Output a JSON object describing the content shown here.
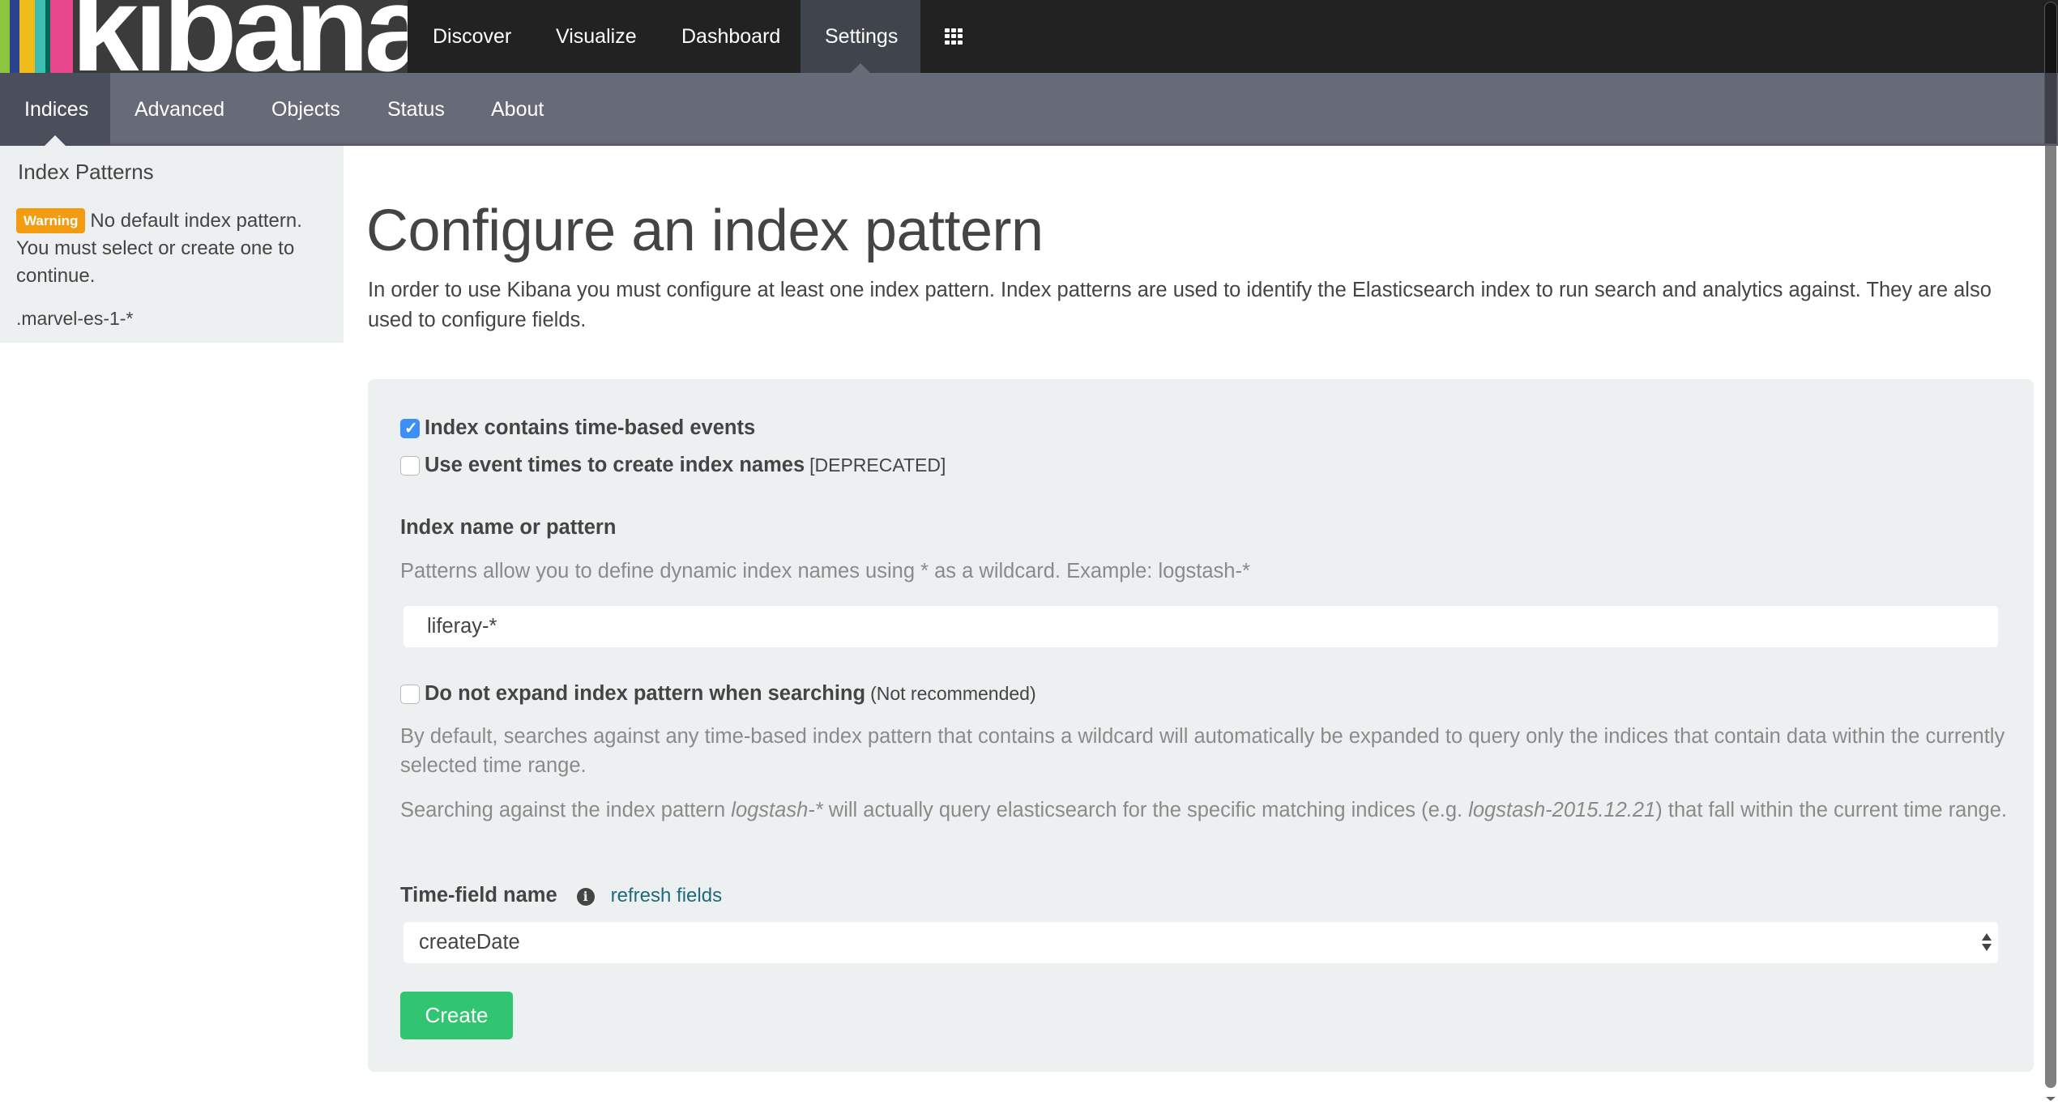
{
  "brand": {
    "name": "kibana",
    "stripe_colors": [
      "#8cc63f",
      "#2a438d",
      "#f2bb1c",
      "#3ebeb0",
      "#00675a",
      "#e8488b"
    ]
  },
  "topnav": {
    "items": [
      {
        "label": "Discover",
        "active": false
      },
      {
        "label": "Visualize",
        "active": false
      },
      {
        "label": "Dashboard",
        "active": false
      },
      {
        "label": "Settings",
        "active": true
      }
    ],
    "apps_icon": "grid-icon"
  },
  "subnav": {
    "items": [
      {
        "label": "Indices",
        "active": true
      },
      {
        "label": "Advanced",
        "active": false
      },
      {
        "label": "Objects",
        "active": false
      },
      {
        "label": "Status",
        "active": false
      },
      {
        "label": "About",
        "active": false
      }
    ]
  },
  "sidebar": {
    "title": "Index Patterns",
    "warning_badge": "Warning",
    "warning_text": "No default index pattern. You must select or create one to continue.",
    "patterns": [
      ".marvel-es-1-*"
    ]
  },
  "main": {
    "title": "Configure an index pattern",
    "description": "In order to use Kibana you must configure at least one index pattern. Index patterns are used to identify the Elasticsearch index to run search and analytics against. They are also used to configure fields.",
    "form": {
      "time_based": {
        "label": "Index contains time-based events",
        "checked": true
      },
      "event_times": {
        "label": "Use event times to create index names",
        "aside": "[DEPRECATED]",
        "checked": false
      },
      "index_name_label": "Index name or pattern",
      "index_name_help": "Patterns allow you to define dynamic index names using * as a wildcard. Example: logstash-*",
      "index_name_value": "liferay-*",
      "no_expand": {
        "label": "Do not expand index pattern when searching",
        "aside": "(Not recommended)",
        "checked": false
      },
      "expand_help_1": "By default, searches against any time-based index pattern that contains a wildcard will automatically be expanded to query only the indices that contain data within the currently selected time range.",
      "expand_help_2_pre": "Searching against the index pattern ",
      "expand_help_2_em1": "logstash-*",
      "expand_help_2_mid": " will actually query elasticsearch for the specific matching indices (e.g. ",
      "expand_help_2_em2": "logstash-2015.12.21",
      "expand_help_2_post": ") that fall within the current time range.",
      "time_field_label": "Time-field name",
      "info_icon": "info-icon",
      "refresh_link": "refresh fields",
      "time_field_value": "createDate",
      "create_button": "Create"
    }
  },
  "colors": {
    "accent_green": "#31c471",
    "checkbox_blue": "#3d8ef7",
    "warning_orange": "#f39c12",
    "link_teal": "#1f6b7a"
  }
}
